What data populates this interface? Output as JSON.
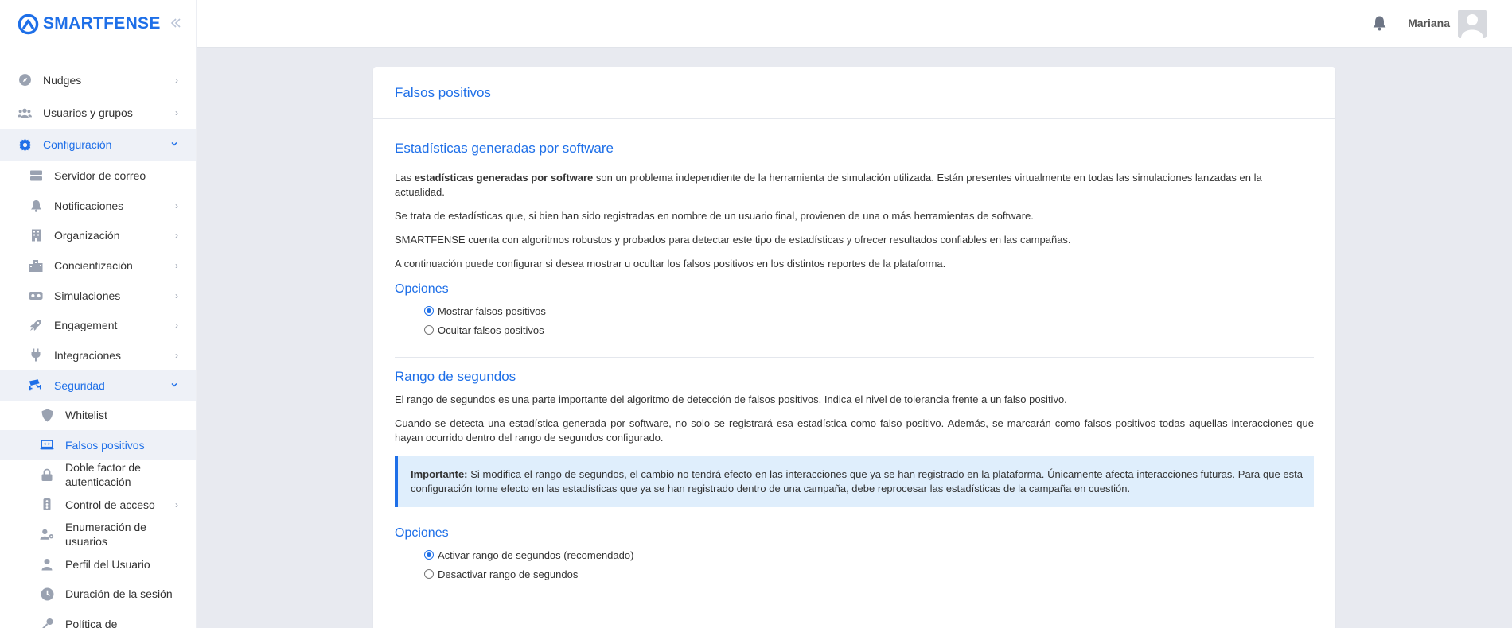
{
  "brand": {
    "name": "SMARTFENSE",
    "collapse_icon": "double-chevron-left-icon"
  },
  "header": {
    "user_name": "Mariana",
    "bell_icon": "bell-icon"
  },
  "sidebar": {
    "items": [
      {
        "label": "Nudges",
        "icon": "compass-icon"
      },
      {
        "label": "Usuarios y grupos",
        "icon": "users-icon"
      },
      {
        "label": "Configuración",
        "icon": "gear-icon"
      }
    ],
    "config_sub": [
      {
        "label": "Servidor de correo",
        "icon": "server-icon"
      },
      {
        "label": "Notificaciones",
        "icon": "bell-icon"
      },
      {
        "label": "Organización",
        "icon": "building-icon"
      },
      {
        "label": "Concientización",
        "icon": "city-icon"
      },
      {
        "label": "Simulaciones",
        "icon": "vr-icon"
      },
      {
        "label": "Engagement",
        "icon": "rocket-icon"
      },
      {
        "label": "Integraciones",
        "icon": "plug-icon"
      },
      {
        "label": "Seguridad",
        "icon": "cctv-icon"
      }
    ],
    "security_sub": [
      {
        "label": "Whitelist",
        "icon": "shield-icon"
      },
      {
        "label": "Falsos positivos",
        "icon": "laptop-code-icon"
      },
      {
        "label": "Doble factor de autenticación",
        "icon": "lock-icon"
      },
      {
        "label": "Control de acceso",
        "icon": "traffic-light-icon"
      },
      {
        "label": "Enumeración de usuarios",
        "icon": "user-gear-icon"
      },
      {
        "label": "Perfil del Usuario",
        "icon": "user-icon"
      },
      {
        "label": "Duración de la sesión",
        "icon": "clock-icon"
      },
      {
        "label": "Política de",
        "icon": "key-icon"
      }
    ]
  },
  "page": {
    "title": "Falsos positivos",
    "section1": {
      "title": "Estadísticas generadas por software",
      "p1_bold": "estadísticas generadas por software",
      "p1_pre": "Las ",
      "p1_post": " son un problema independiente de la herramienta de simulación utilizada. Están presentes virtualmente en todas las simulaciones lanzadas en la actualidad.",
      "p2": "Se trata de estadísticas que, si bien han sido registradas en nombre de un usuario final, provienen de una o más herramientas de software.",
      "p3": "SMARTFENSE cuenta con algoritmos robustos y probados para detectar este tipo de estadísticas y ofrecer resultados confiables en las campañas.",
      "p4": "A continuación puede configurar si desea mostrar u ocultar los falsos positivos en los distintos reportes de la plataforma.",
      "options_title": "Opciones",
      "opt1": "Mostrar falsos positivos",
      "opt2": "Ocultar falsos positivos"
    },
    "section2": {
      "title": "Rango de segundos",
      "p1": "El rango de segundos es una parte importante del algoritmo de detección de falsos positivos. Indica el nivel de tolerancia frente a un falso positivo.",
      "p2": "Cuando se detecta una estadística generada por software, no solo se registrará esa estadística como falso positivo. Además, se marcarán como falsos positivos todas aquellas interacciones que hayan ocurrido dentro del rango de segundos configurado.",
      "alert_bold": "Importante:",
      "alert_text": " Si modifica el rango de segundos, el cambio no tendrá efecto en las interacciones que ya se han registrado en la plataforma. Únicamente afecta interacciones futuras. Para que esta configuración tome efecto en las estadísticas que ya se han registrado dentro de una campaña, debe reprocesar las estadísticas de la campaña en cuestión.",
      "options_title": "Opciones",
      "opt1": "Activar rango de segundos (recomendado)",
      "opt2": "Desactivar rango de segundos"
    }
  },
  "colors": {
    "accent": "#1e6fe8",
    "alert_bg": "#dfeefc",
    "bg": "#e8eaf0"
  }
}
